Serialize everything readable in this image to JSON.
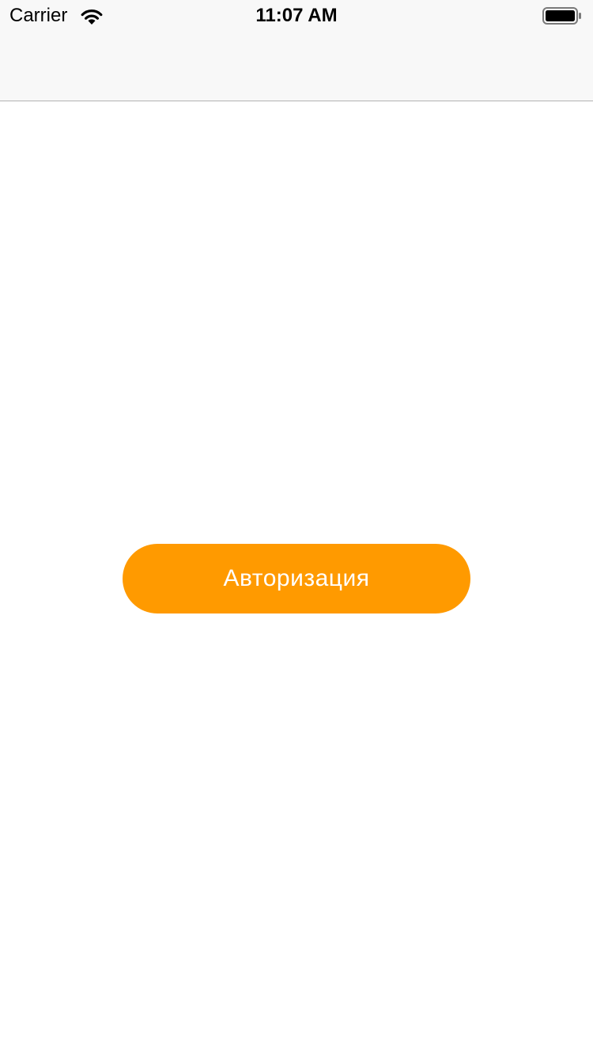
{
  "status_bar": {
    "carrier": "Carrier",
    "time": "11:07 AM",
    "wifi_icon": "wifi-icon",
    "battery_icon": "battery-icon"
  },
  "main": {
    "auth_button": {
      "label": "Авторизация"
    }
  },
  "colors": {
    "accent": "#FF9A00",
    "bar_background": "#F8F8F8",
    "bar_border": "#B2B2B2",
    "button_text": "#FFFFFF"
  }
}
